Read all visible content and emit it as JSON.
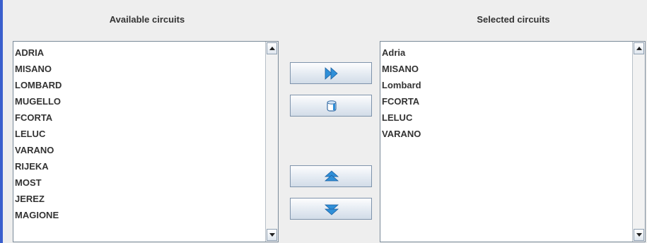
{
  "left_panel": {
    "title": "Available circuits",
    "items": [
      "ADRIA",
      "MISANO",
      "LOMBARD",
      "MUGELLO",
      "FCORTA",
      "LELUC",
      "VARANO",
      "RIJEKA",
      "MOST",
      "JEREZ",
      "MAGIONE"
    ]
  },
  "right_panel": {
    "title": "Selected circuits",
    "items": [
      "Adria",
      "MISANO",
      "Lombard",
      "FCORTA",
      "LELUC",
      "VARANO"
    ]
  },
  "buttons": {
    "add_icon": "double-right-arrow-icon",
    "remove_icon": "cylinder-icon",
    "up_icon": "up-arrow-icon",
    "down_icon": "down-arrow-icon"
  },
  "colors": {
    "accent_bar": "#3a5fcd",
    "icon_blue": "#2f8fd8"
  }
}
